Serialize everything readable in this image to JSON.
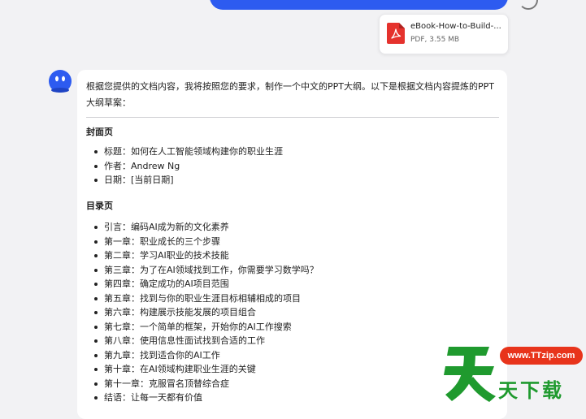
{
  "file": {
    "name": "eBook-How-to-Build-...",
    "meta": "PDF, 3.55 MB",
    "icon": "pdf-file-icon"
  },
  "message": {
    "intro": "根据您提供的文档内容，我将按照您的要求，制作一个中文的PPT大纲。以下是根据文档内容提炼的PPT大纲草案：",
    "sections": [
      {
        "title": "封面页",
        "items": [
          "标题：如何在人工智能领域构建你的职业生涯",
          "作者：Andrew Ng",
          "日期：[当前日期]"
        ]
      },
      {
        "title": "目录页",
        "items": [
          "引言：编码AI成为新的文化素养",
          "第一章：职业成长的三个步骤",
          "第二章：学习AI职业的技术技能",
          "第三章：为了在AI领域找到工作，你需要学习数学吗？",
          "第四章：确定成功的AI项目范围",
          "第五章：找到与你的职业生涯目标相辅相成的项目",
          "第六章：构建展示技能发展的项目组合",
          "第七章：一个简单的框架，开始你的AI工作搜索",
          "第八章：使用信息性面试找到合适的工作",
          "第九章：找到适合你的AI工作",
          "第十章：在AI领域构建职业生涯的关键",
          "第十一章：克服冒名顶替综合症",
          "结语：让每一天都有价值"
        ]
      }
    ]
  },
  "watermark": {
    "url": "www.TTzip.com",
    "text": "天下载"
  },
  "colors": {
    "user_bubble": "#2d5bf0",
    "pdf_red": "#e5322d",
    "bot_avatar": "#2d5bf0",
    "watermark_green": "#1f9a2e",
    "watermark_red": "#e8341b"
  }
}
